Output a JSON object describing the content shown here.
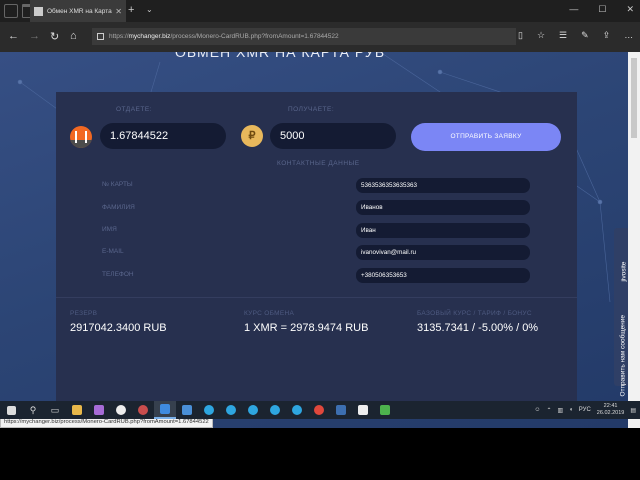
{
  "browser": {
    "tab_title": "Обмен XMR на Карта Р",
    "tab_close": "✕",
    "new_tab": "+",
    "tab_dropdown": "⌄",
    "window_controls": [
      "—",
      "☐",
      "✕"
    ],
    "nav_back": "←",
    "nav_forward": "→",
    "nav_refresh": "↻",
    "nav_home": "⌂",
    "url_prefix": "https://",
    "url_domain": "mychanger.biz",
    "url_path": "/process/Monero-CardRUB.php?fromAmount=1.67844522",
    "icons": [
      "reading-view-icon",
      "favorite-star-icon",
      "favorites-hub-icon",
      "notes-icon",
      "share-icon",
      "more-icon"
    ],
    "icon_glyphs": [
      "▯",
      "☆",
      "☰",
      "✎",
      "⇪",
      "…"
    ]
  },
  "page": {
    "heading": "ОБМЕН XMR НА КАРТА РУБ",
    "give_label": "ОТДАЕТЕ:",
    "get_label": "ПОЛУЧАЕТЕ:",
    "give_amount": "1.67844522",
    "get_amount": "5000",
    "ruble_symbol": "₽",
    "submit_label": "ОТПРАВИТЬ ЗАЯВКУ",
    "contact_heading": "КОНТАКТНЫЕ ДАННЫЕ",
    "fields": [
      {
        "label": "№ КАРТЫ",
        "value": "5363536353635363"
      },
      {
        "label": "ФАМИЛИЯ",
        "value": "Иванов"
      },
      {
        "label": "ИМЯ",
        "value": "Иван"
      },
      {
        "label": "E-MAIL",
        "value": "ivanovivan@mail.ru"
      },
      {
        "label": "ТЕЛЕФОН",
        "value": "+380506353653"
      }
    ],
    "stats": [
      {
        "label": "РЕЗЕРВ",
        "value": "2917042.3400 RUB"
      },
      {
        "label": "КУРС ОБМЕНА",
        "value": "1 XMR = 2978.9474 RUB"
      },
      {
        "label": "БАЗОВЫЙ КУРС / ТАРИФ / БОНУС",
        "value": "3135.7341 / -5.00% / 0%"
      }
    ],
    "feedback_label": "Отправить нам сообщение",
    "feedback_brand": "jivosite"
  },
  "status_url": "https://mychanger.biz/process/Monero-CardRUB.php?fromAmount=1.67844522",
  "taskbar": {
    "tray_lang": "РУС",
    "time": "22:41",
    "date": "26.02.2019",
    "tray_up": "⌃"
  },
  "colors": {
    "page_bg": "#2c4575",
    "panel_bg": "#27304f",
    "input_bg": "#141b33",
    "submit_bg": "#7b86f5",
    "monero_orange": "#f26822",
    "ruble_gold": "#e8b85c"
  }
}
